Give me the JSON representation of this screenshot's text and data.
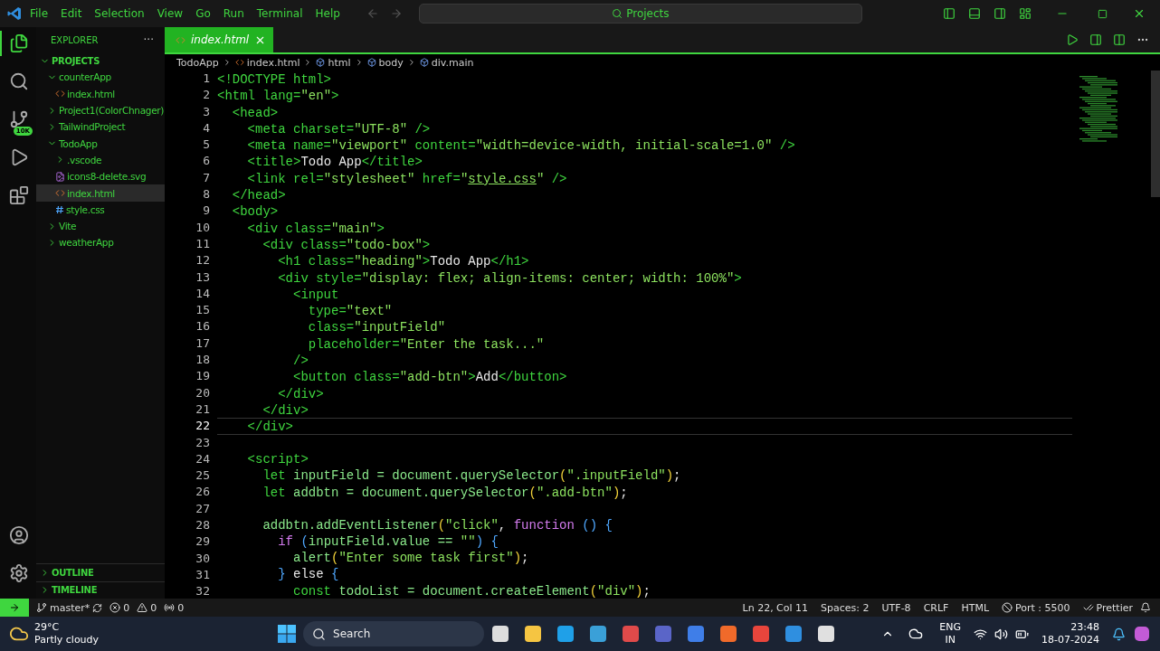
{
  "menu": [
    "File",
    "Edit",
    "Selection",
    "View",
    "Go",
    "Run",
    "Terminal",
    "Help"
  ],
  "command_center": {
    "placeholder": "Projects"
  },
  "activity_bar": {
    "badge": "10K"
  },
  "explorer": {
    "title": "EXPLORER",
    "more": "···",
    "root": "PROJECTS",
    "root_expanded": true,
    "items": [
      {
        "label": "counterApp",
        "kind": "folder",
        "expanded": true,
        "selected": false,
        "children": [
          {
            "label": "index.html",
            "kind": "html",
            "selected": false
          }
        ]
      },
      {
        "label": "Project1(ColorChnager)",
        "kind": "folder",
        "expanded": false,
        "selected": false
      },
      {
        "label": "TailwindProject",
        "kind": "folder",
        "expanded": false,
        "selected": false
      },
      {
        "label": "TodoApp",
        "kind": "folder",
        "expanded": true,
        "selected": false,
        "children": [
          {
            "label": ".vscode",
            "kind": "folder",
            "expanded": false,
            "selected": false
          },
          {
            "label": "icons8-delete.svg",
            "kind": "svg",
            "selected": false
          },
          {
            "label": "index.html",
            "kind": "html",
            "selected": true
          },
          {
            "label": "style.css",
            "kind": "css",
            "selected": false
          }
        ]
      },
      {
        "label": "Vite",
        "kind": "folder",
        "expanded": false,
        "selected": false
      },
      {
        "label": "weatherApp",
        "kind": "folder",
        "expanded": false,
        "selected": false
      }
    ],
    "sections": [
      {
        "label": "OUTLINE",
        "expanded": false
      },
      {
        "label": "TIMELINE",
        "expanded": false
      }
    ]
  },
  "tabs": [
    {
      "label": "index.html",
      "selected": true
    }
  ],
  "breadcrumbs": [
    {
      "label": "TodoApp",
      "kind": "folder"
    },
    {
      "label": "index.html",
      "kind": "html"
    },
    {
      "label": "html",
      "kind": "element"
    },
    {
      "label": "body",
      "kind": "element"
    },
    {
      "label": "div.main",
      "kind": "element"
    }
  ],
  "lines": [
    {
      "n": "1",
      "current": false,
      "code": [
        {
          "kind": "tag",
          "text": "<!DOCTYPE html>"
        }
      ]
    },
    {
      "n": "2",
      "current": false,
      "code": [
        {
          "kind": "tag",
          "text": "<html lang="
        },
        {
          "kind": "string",
          "text": "\"en\""
        },
        {
          "kind": "tag",
          "text": ">"
        }
      ]
    },
    {
      "n": "3",
      "current": false,
      "code": [
        {
          "kind": "tag",
          "text": "  <head>"
        }
      ]
    },
    {
      "n": "4",
      "current": false,
      "code": [
        {
          "kind": "tag",
          "text": "    <meta charset="
        },
        {
          "kind": "string",
          "text": "\"UTF-8\""
        },
        {
          "kind": "tag",
          "text": " />"
        }
      ]
    },
    {
      "n": "5",
      "current": false,
      "code": [
        {
          "kind": "tag",
          "text": "    <meta name="
        },
        {
          "kind": "string",
          "text": "\"viewport\""
        },
        {
          "kind": "tag",
          "text": " content="
        },
        {
          "kind": "string",
          "text": "\"width=device-width, initial-scale=1.0\""
        },
        {
          "kind": "tag",
          "text": " />"
        }
      ]
    },
    {
      "n": "6",
      "current": false,
      "code": [
        {
          "kind": "tag",
          "text": "    <title>"
        },
        {
          "kind": "text",
          "text": "Todo App"
        },
        {
          "kind": "tag",
          "text": "</title>"
        }
      ]
    },
    {
      "n": "7",
      "current": false,
      "code": [
        {
          "kind": "tag",
          "text": "    <link rel="
        },
        {
          "kind": "string",
          "text": "\"stylesheet\""
        },
        {
          "kind": "tag",
          "text": " href="
        },
        {
          "kind": "string",
          "text": "\""
        },
        {
          "kind": "link",
          "text": "style.css"
        },
        {
          "kind": "string",
          "text": "\""
        },
        {
          "kind": "tag",
          "text": " />"
        }
      ]
    },
    {
      "n": "8",
      "current": false,
      "code": [
        {
          "kind": "tag",
          "text": "  </head>"
        }
      ]
    },
    {
      "n": "9",
      "current": false,
      "code": [
        {
          "kind": "tag",
          "text": "  <body>"
        }
      ]
    },
    {
      "n": "10",
      "current": false,
      "code": [
        {
          "kind": "tag",
          "text": "    <div class="
        },
        {
          "kind": "string",
          "text": "\"main\""
        },
        {
          "kind": "tag",
          "text": ">"
        }
      ]
    },
    {
      "n": "11",
      "current": false,
      "code": [
        {
          "kind": "tag",
          "text": "      <div class="
        },
        {
          "kind": "string",
          "text": "\"todo-box\""
        },
        {
          "kind": "tag",
          "text": ">"
        }
      ]
    },
    {
      "n": "12",
      "current": false,
      "code": [
        {
          "kind": "tag",
          "text": "        <h1 class="
        },
        {
          "kind": "string",
          "text": "\"heading\""
        },
        {
          "kind": "tag",
          "text": ">"
        },
        {
          "kind": "text",
          "text": "Todo App"
        },
        {
          "kind": "tag",
          "text": "</h1>"
        }
      ]
    },
    {
      "n": "13",
      "current": false,
      "code": [
        {
          "kind": "tag",
          "text": "        <div style="
        },
        {
          "kind": "string",
          "text": "\"display: flex; align-items: center; width: 100%\""
        },
        {
          "kind": "tag",
          "text": ">"
        }
      ]
    },
    {
      "n": "14",
      "current": false,
      "code": [
        {
          "kind": "tag",
          "text": "          <input"
        }
      ]
    },
    {
      "n": "15",
      "current": false,
      "code": [
        {
          "kind": "tag",
          "text": "            type="
        },
        {
          "kind": "string",
          "text": "\"text\""
        }
      ]
    },
    {
      "n": "16",
      "current": false,
      "code": [
        {
          "kind": "tag",
          "text": "            class="
        },
        {
          "kind": "string",
          "text": "\"inputField\""
        }
      ]
    },
    {
      "n": "17",
      "current": false,
      "code": [
        {
          "kind": "tag",
          "text": "            placeholder="
        },
        {
          "kind": "string",
          "text": "\"Enter the task...\""
        }
      ]
    },
    {
      "n": "18",
      "current": false,
      "code": [
        {
          "kind": "tag",
          "text": "          />"
        }
      ]
    },
    {
      "n": "19",
      "current": false,
      "code": [
        {
          "kind": "tag",
          "text": "          <button class="
        },
        {
          "kind": "string",
          "text": "\"add-btn\""
        },
        {
          "kind": "tag",
          "text": ">"
        },
        {
          "kind": "text",
          "text": "Add"
        },
        {
          "kind": "tag",
          "text": "</button>"
        }
      ]
    },
    {
      "n": "20",
      "current": false,
      "code": [
        {
          "kind": "tag",
          "text": "        </div>"
        }
      ]
    },
    {
      "n": "21",
      "current": false,
      "code": [
        {
          "kind": "tag",
          "text": "      </div>"
        }
      ]
    },
    {
      "n": "22",
      "current": true,
      "code": [
        {
          "kind": "tag",
          "text": "    </div>"
        }
      ]
    },
    {
      "n": "23",
      "current": false
    },
    {
      "n": "24",
      "current": false,
      "code": [
        {
          "kind": "tag",
          "text": "    <script>"
        }
      ]
    },
    {
      "n": "25",
      "current": false,
      "code": [
        {
          "kind": "decl",
          "text": "      let "
        },
        {
          "kind": "ident",
          "text": "inputField = document.querySelector"
        },
        {
          "kind": "paren",
          "text": "("
        },
        {
          "kind": "string",
          "text": "\".inputField\""
        },
        {
          "kind": "paren",
          "text": ")"
        },
        {
          "kind": "text",
          "text": ";"
        }
      ]
    },
    {
      "n": "26",
      "current": false,
      "code": [
        {
          "kind": "decl",
          "text": "      let "
        },
        {
          "kind": "ident",
          "text": "addbtn = document.querySelector"
        },
        {
          "kind": "paren",
          "text": "("
        },
        {
          "kind": "string",
          "text": "\".add-btn\""
        },
        {
          "kind": "paren",
          "text": ")"
        },
        {
          "kind": "text",
          "text": ";"
        }
      ]
    },
    {
      "n": "27",
      "current": false
    },
    {
      "n": "28",
      "current": false,
      "code": [
        {
          "kind": "ident",
          "text": "      addbtn.addEventListener"
        },
        {
          "kind": "paren",
          "text": "("
        },
        {
          "kind": "string",
          "text": "\"click\""
        },
        {
          "kind": "text",
          "text": ", "
        },
        {
          "kind": "keyword",
          "text": "function "
        },
        {
          "kind": "brace",
          "text": "() {"
        }
      ]
    },
    {
      "n": "29",
      "current": false,
      "code": [
        {
          "kind": "keyword",
          "text": "        if "
        },
        {
          "kind": "brace",
          "text": "("
        },
        {
          "kind": "ident",
          "text": "inputField.value == "
        },
        {
          "kind": "string",
          "text": "\"\""
        },
        {
          "kind": "brace",
          "text": ") {"
        }
      ]
    },
    {
      "n": "30",
      "current": false,
      "code": [
        {
          "kind": "ident",
          "text": "          alert"
        },
        {
          "kind": "paren",
          "text": "("
        },
        {
          "kind": "string",
          "text": "\"Enter some task first\""
        },
        {
          "kind": "paren",
          "text": ")"
        },
        {
          "kind": "text",
          "text": ";"
        }
      ]
    },
    {
      "n": "31",
      "current": false,
      "code": [
        {
          "kind": "brace",
          "text": "        } "
        },
        {
          "kind": "text",
          "text": "else "
        },
        {
          "kind": "brace",
          "text": "{"
        }
      ]
    },
    {
      "n": "32",
      "current": false,
      "code": [
        {
          "kind": "decl",
          "text": "          const "
        },
        {
          "kind": "ident",
          "text": "todoList = document.createElement"
        },
        {
          "kind": "paren",
          "text": "("
        },
        {
          "kind": "string",
          "text": "\"div\""
        },
        {
          "kind": "paren",
          "text": ")"
        },
        {
          "kind": "text",
          "text": ";"
        }
      ]
    }
  ],
  "status_bar": {
    "left": [
      {
        "label": "master*",
        "kind": "branch"
      },
      {
        "label": "0",
        "kind": "errors"
      },
      {
        "label": "0",
        "kind": "warnings"
      },
      {
        "label": "0",
        "kind": "ports"
      }
    ],
    "right": [
      {
        "label": "Ln 22, Col 11",
        "kind": "text"
      },
      {
        "label": "Spaces: 2",
        "kind": "text"
      },
      {
        "label": "UTF-8",
        "kind": "text"
      },
      {
        "label": "CRLF",
        "kind": "text"
      },
      {
        "label": "HTML",
        "kind": "text"
      },
      {
        "label": "Port : 5500",
        "kind": "port"
      },
      {
        "label": "Prettier",
        "kind": "prettier"
      },
      {
        "kind": "bell"
      }
    ]
  },
  "taskbar": {
    "weather": {
      "temp": "29°C",
      "summary": "Partly cloudy"
    },
    "search": {
      "placeholder": "Search"
    },
    "lang": {
      "top": "ENG",
      "bottom": "IN"
    },
    "time": "23:48",
    "date": "18-07-2024"
  }
}
